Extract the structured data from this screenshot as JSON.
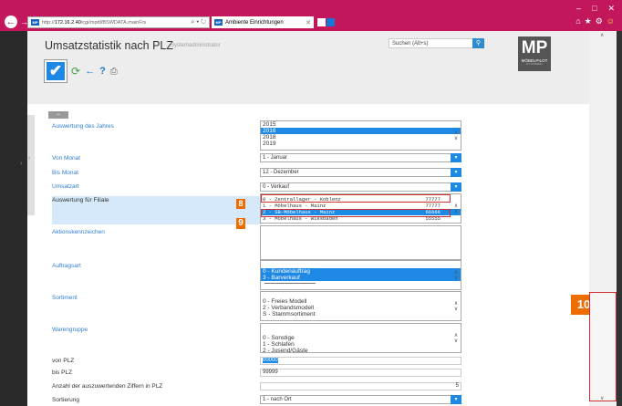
{
  "browser": {
    "url_prefix": "http://",
    "url_host": "172.16.2.40",
    "url_rest": "/cgi/mpdl/BSWDATA.mainFrs",
    "address_controls": "⌕ ▾ ↻",
    "tab_title": "Ambiente Einrichtungen",
    "window_controls": [
      "–",
      "□",
      "✕"
    ],
    "browser_icons": [
      "⌂",
      "★",
      "⚙",
      "☺"
    ]
  },
  "app": {
    "title": "Umsatzstatistik nach PLZ",
    "subtitle": "Systemadministrator",
    "search_placeholder": "Suchen (Alt+s)",
    "logo_text": "MP",
    "logo_brand": "MÖBELPILOT",
    "logo_tag": "BY SCHAREIN"
  },
  "toolbar": {
    "icons": [
      "check-icon",
      "refresh-icon",
      "back-icon",
      "help-icon",
      "print-icon"
    ],
    "glyphs": {
      "check": "✔",
      "refresh": "⟳",
      "back": "←",
      "help": "?",
      "print": "⎙"
    }
  },
  "form": {
    "collapse_label": "–",
    "jahr": {
      "label": "Auswertung des Jahres",
      "options": [
        "2015",
        "2016",
        "2018",
        "2019"
      ],
      "selected": "2016"
    },
    "von_monat": {
      "label": "Von Monat",
      "value": "1 - Januar"
    },
    "bis_monat": {
      "label": "Bis Monat",
      "value": "12 - Dezember"
    },
    "umsatzart": {
      "label": "Umsatzart",
      "value": "0 - Verkauf"
    },
    "filiale": {
      "label": "Auswertung für Filiale",
      "options": [
        {
          "name": "0 - Zentrallager - Koblenz",
          "plz": "77777"
        },
        {
          "name": "1 - Möbelhaus - Mainz",
          "plz": "77777"
        },
        {
          "name": "2 - SB-Möbelhaus - Mainz",
          "plz": "66666"
        },
        {
          "name": "3 - Möbelhaus - Wiesbaden",
          "plz": "55555"
        }
      ],
      "selected_index": 2
    },
    "aktion": {
      "label": "Aktionskennzeichen"
    },
    "auftragsart": {
      "label": "Auftragsart",
      "options": [
        "0 - Kundenauftrag",
        "3 - Barverkauf"
      ],
      "selected": [
        "0 - Kundenauftrag",
        "3 - Barverkauf"
      ]
    },
    "sortiment": {
      "label": "Sortiment",
      "options": [
        "0 - Freies Modell",
        "2 - Verbandsmodell",
        "S - Stammsortiment"
      ]
    },
    "warengruppe": {
      "label": "Warengruppe",
      "options": [
        "0 - Sonstige",
        "1 - Schlafen",
        "2 - Jusend/Gäste"
      ]
    },
    "von_plz": {
      "label": "von PLZ",
      "value": "00000"
    },
    "bis_plz": {
      "label": "bis PLZ",
      "value": "99999"
    },
    "ziffern": {
      "label": "Anzahl der auszuwertenden Ziffern in PLZ",
      "value": "5"
    },
    "sortierung": {
      "label": "Sortierung",
      "value": "1 - nach Ort"
    }
  },
  "annotations": {
    "badge_8": "8",
    "badge_9": "9",
    "badge_10": "10",
    "color": "#ef6c00",
    "box_color": "#d32f2f"
  },
  "scroll_glyphs": {
    "up": "∧",
    "down": "∨",
    "dd": "▾"
  }
}
